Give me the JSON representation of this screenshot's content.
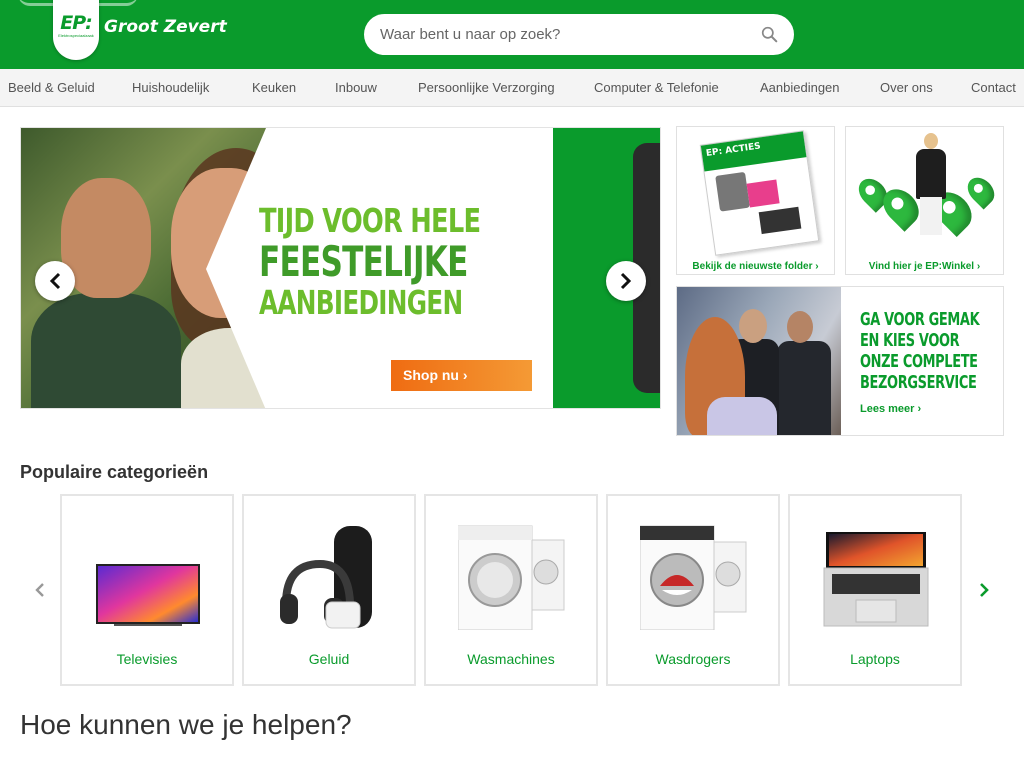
{
  "header": {
    "logo_text": "EP:",
    "logo_sub": "Elektrospeciaalzaak",
    "store_name": "Groot Zevert",
    "search_placeholder": "Waar bent u naar op zoek?",
    "brand_color": "#0a9b2c"
  },
  "nav": {
    "items": [
      "Beeld & Geluid",
      "Huishoudelijk",
      "Keuken",
      "Inbouw",
      "Persoonlijke Verzorging",
      "Computer & Telefonie",
      "Aanbiedingen",
      "Over ons",
      "Contact"
    ]
  },
  "hero": {
    "line1": "Tijd voor hele",
    "line2": "Feestelijke",
    "line3": "Aanbiedingen",
    "cta": "Shop nu ›",
    "accent_color": "#ef6c12"
  },
  "promos": {
    "folder": {
      "caption": "Bekijk de nieuwste folder ›",
      "folder_title": "EP: ACTIES"
    },
    "winkel": {
      "caption": "Vind hier je EP:Winkel ›"
    },
    "bezorg": {
      "text": "Ga voor gemak en kies voor onze complete bezorgservice",
      "line1": "Ga voor gemak",
      "line2": "en kies voor",
      "line3": "onze complete",
      "line4": "bezorgservice",
      "link": "Lees meer ›"
    }
  },
  "categories": {
    "title": "Populaire categorieën",
    "items": [
      {
        "label": "Televisies",
        "icon": "television-icon"
      },
      {
        "label": "Geluid",
        "icon": "headphones-speaker-icon"
      },
      {
        "label": "Wasmachines",
        "icon": "washing-machine-icon"
      },
      {
        "label": "Wasdrogers",
        "icon": "dryer-icon"
      },
      {
        "label": "Laptops",
        "icon": "laptop-icon"
      }
    ]
  },
  "help": {
    "title": "Hoe kunnen we je helpen?"
  }
}
